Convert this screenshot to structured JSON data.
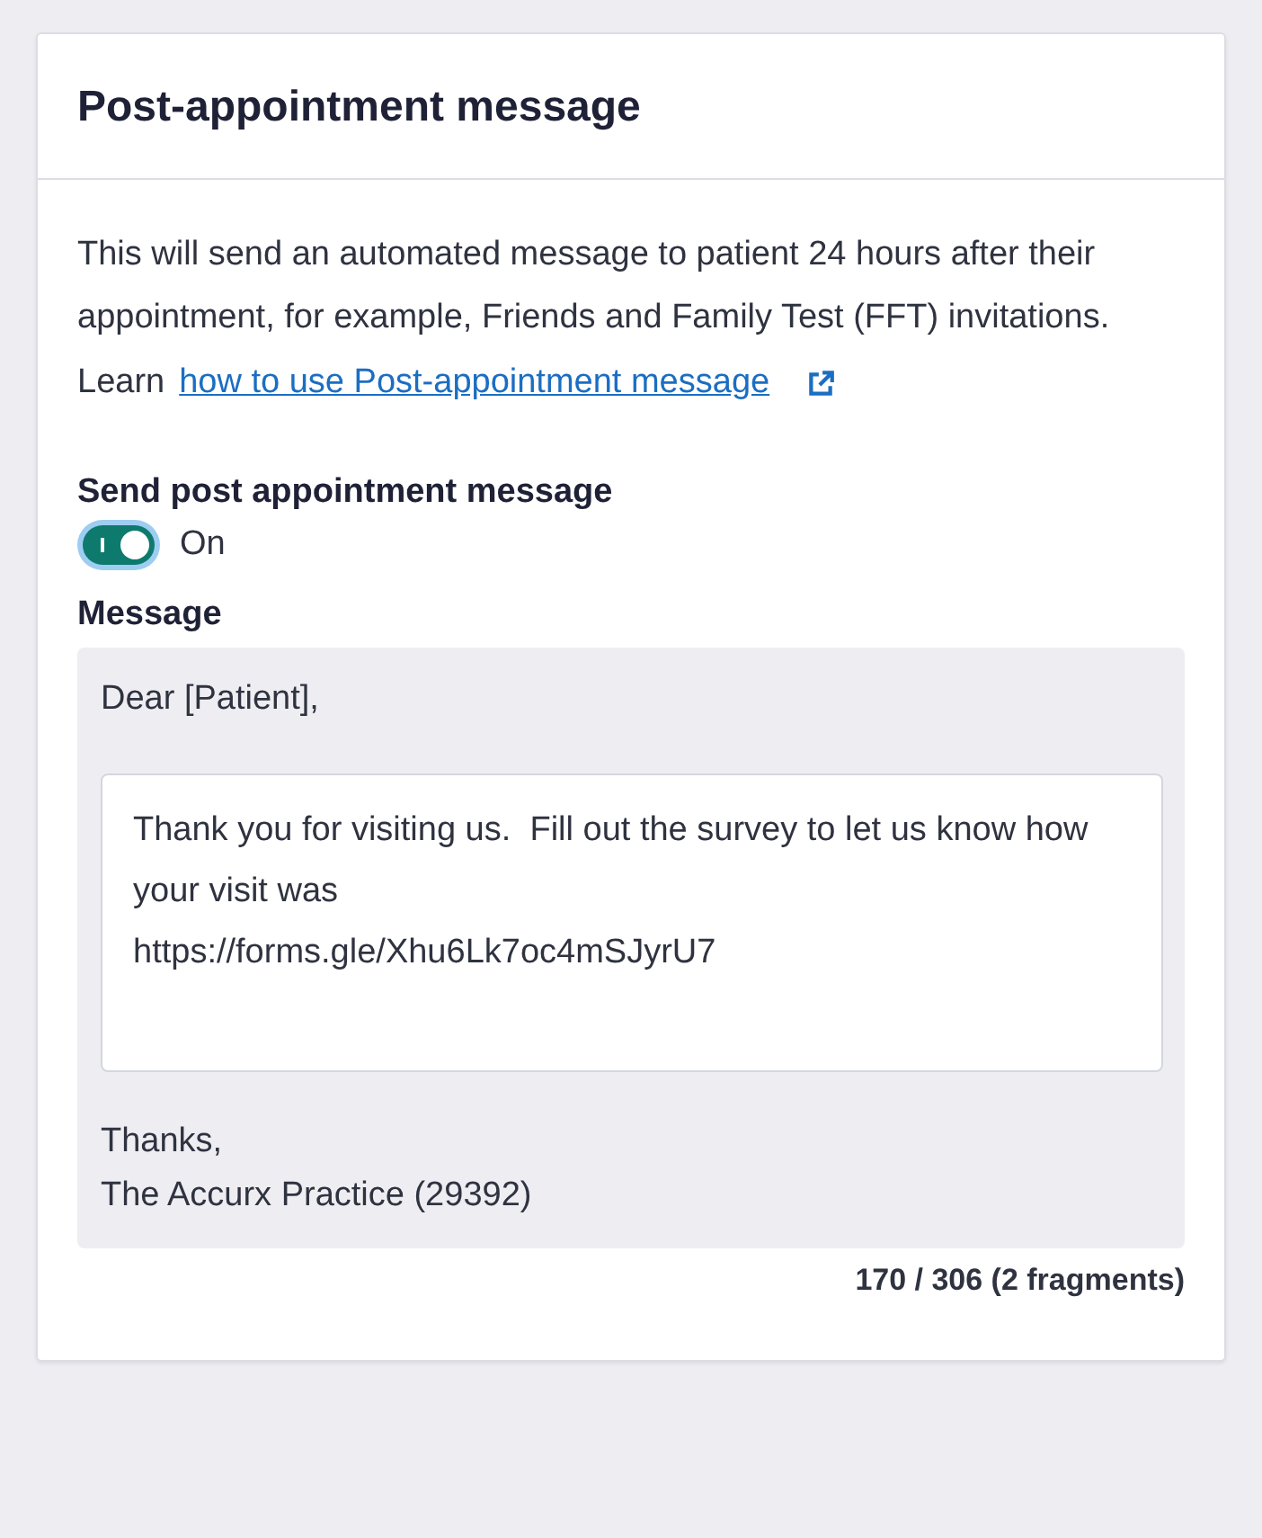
{
  "card": {
    "title": "Post-appointment message",
    "description": "This will send an automated message to patient 24 hours after their appointment, for example, Friends and Family Test (FFT) invitations.",
    "learn": {
      "prefix": "Learn",
      "link": "how to use Post-appointment message"
    },
    "toggle": {
      "label": "Send post appointment message",
      "on": true,
      "state_text": "On"
    },
    "message": {
      "label": "Message",
      "greeting": "Dear [Patient],",
      "body": "Thank you for visiting us.  Fill out the survey to let us know how your visit was\nhttps://forms.gle/Xhu6Lk7oc4mSJyrU7",
      "signoff": [
        "Thanks,",
        "The Accurx Practice (29392)"
      ]
    },
    "counter": "170 / 306 (2 fragments)"
  }
}
